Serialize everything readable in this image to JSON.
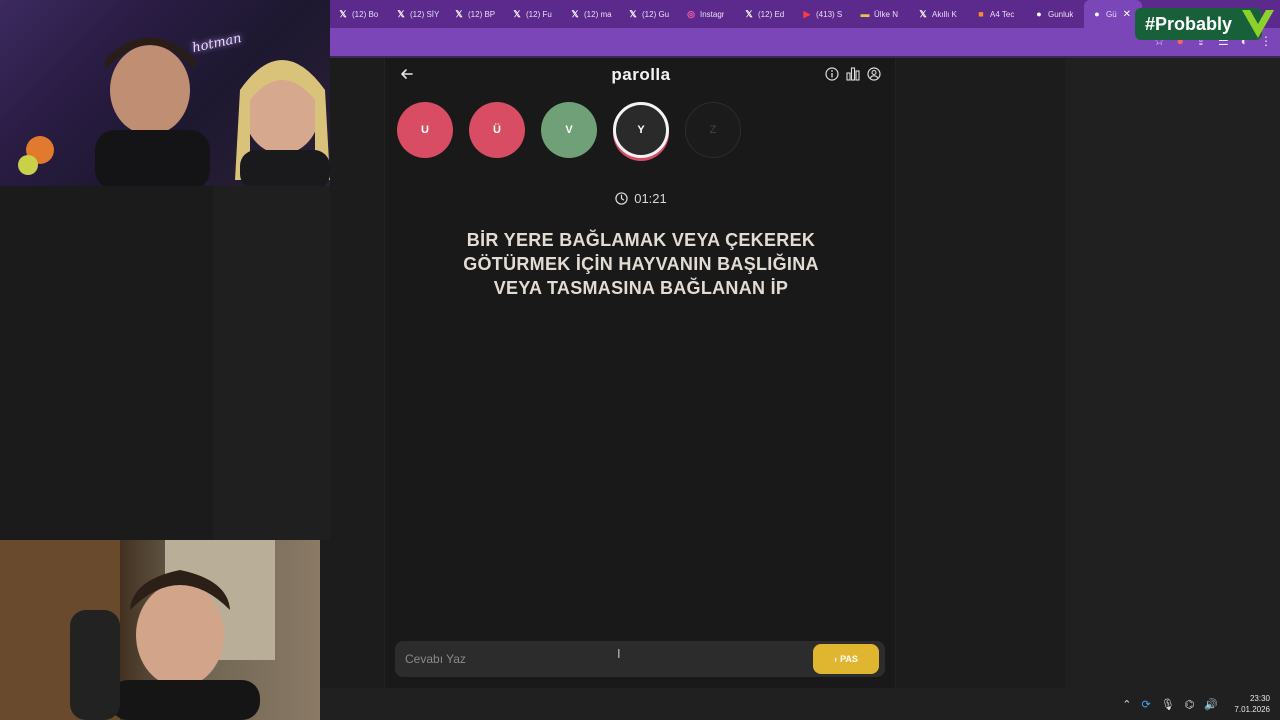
{
  "browser": {
    "tabs": [
      {
        "icon": "x-logo-icon",
        "label": "(12) Bo"
      },
      {
        "icon": "x-logo-icon",
        "label": "(12) SİY"
      },
      {
        "icon": "x-logo-icon",
        "label": "(12) BP"
      },
      {
        "icon": "x-logo-icon",
        "label": "(12) Fu"
      },
      {
        "icon": "x-logo-icon",
        "label": "(12) ma"
      },
      {
        "icon": "x-logo-icon",
        "label": "(12) Gu"
      },
      {
        "icon": "instagram-icon",
        "label": "Instagr"
      },
      {
        "icon": "x-logo-icon",
        "label": "(12) Ed"
      },
      {
        "icon": "youtube-icon",
        "label": "(413) S"
      },
      {
        "icon": "folder-icon",
        "label": "Ülke N"
      },
      {
        "icon": "x-logo-icon",
        "label": "Akıllı K"
      },
      {
        "icon": "hb-icon",
        "label": "A4 Tec"
      },
      {
        "icon": "globe-icon",
        "label": "Gunluk"
      }
    ],
    "active_tab_label": "Gü"
  },
  "overlay": {
    "badge_text": "#Probably"
  },
  "game": {
    "title": "parolla",
    "letters": [
      {
        "char": "U",
        "state": "wrong"
      },
      {
        "char": "Ü",
        "state": "wrong"
      },
      {
        "char": "V",
        "state": "correct"
      },
      {
        "char": "Y",
        "state": "current"
      },
      {
        "char": "Z",
        "state": "pending"
      }
    ],
    "timer": "01:21",
    "question_lines": [
      "BİR YERE BAĞLAMAK VEYA ÇEKEREK",
      "GÖTÜRMEK İÇİN HAYVANIN BAŞLIĞINA",
      "VEYA TASMASINA BAĞLANAN İP"
    ],
    "answer_placeholder": "Cevabı Yaz",
    "answer_value": "",
    "pass_label": "PAS"
  },
  "webcam": {
    "neon_sign": "hotman"
  },
  "taskbar": {
    "time": "23:30",
    "date": "7.01.2026"
  },
  "colors": {
    "wrong": "#d84d63",
    "correct": "#6fa077",
    "pass": "#e0b52f",
    "browser": "#7a46b8"
  }
}
